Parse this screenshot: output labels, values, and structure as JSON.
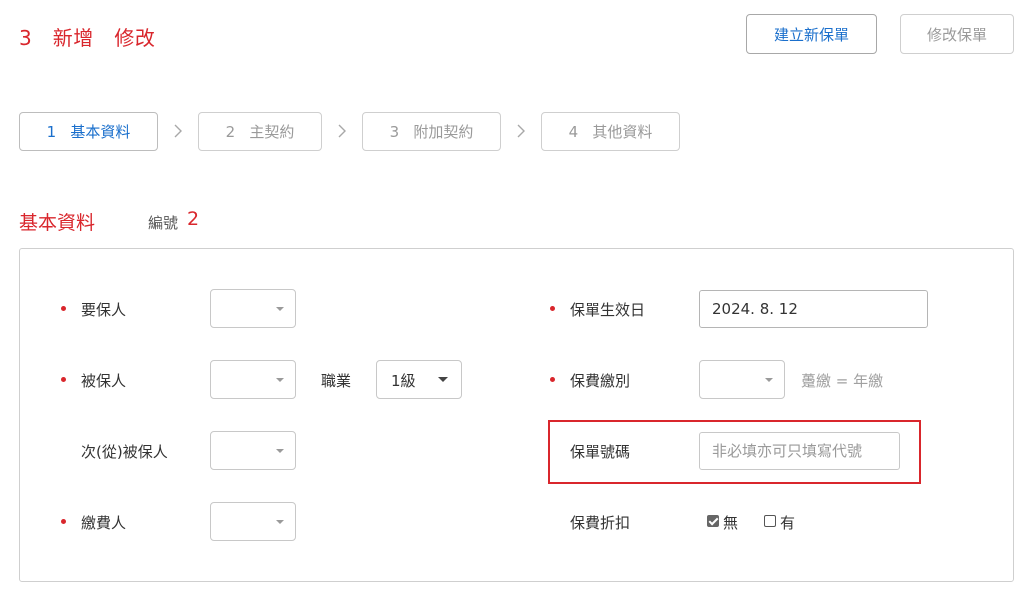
{
  "header": {
    "title": "3   新增   修改",
    "create_button": "建立新保單",
    "modify_button": "修改保單"
  },
  "steps": [
    {
      "label": "1   基本資料",
      "active": true
    },
    {
      "label": "2   主契約",
      "active": false
    },
    {
      "label": "3   附加契約",
      "active": false
    },
    {
      "label": "4   其他資料",
      "active": false
    }
  ],
  "section": {
    "title": "基本資料",
    "id_label": "編號",
    "id_value": "2"
  },
  "form": {
    "proposer_label": "要保人",
    "insured_label": "被保人",
    "occupation_label": "職業",
    "occupation_value": "1級",
    "secondary_insured_label": "次(從)被保人",
    "payer_label": "繳費人",
    "effective_date_label": "保單生效日",
    "effective_date_value": "2024. 8. 12",
    "payment_type_label": "保費繳別",
    "payment_type_note": "躉繳 = 年繳",
    "policy_number_label": "保單號碼",
    "policy_number_placeholder": "非必填亦可只填寫代號",
    "discount_label": "保費折扣",
    "discount_no": "無",
    "discount_yes": "有",
    "discount_selected": "無"
  },
  "colors": {
    "accent_red": "#d9262c",
    "link_blue": "#1a6fcc"
  }
}
